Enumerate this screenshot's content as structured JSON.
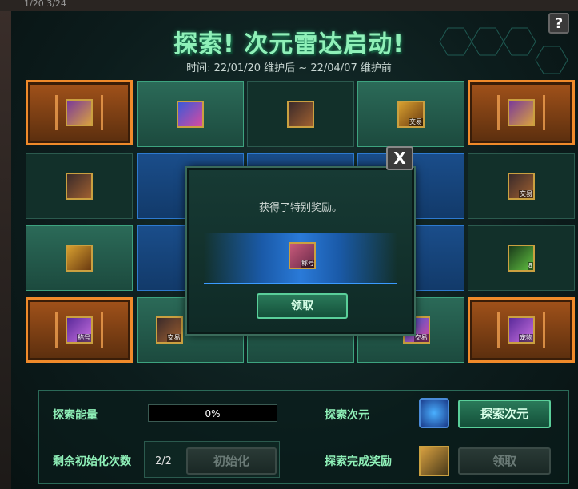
{
  "top_strip_text": "1/20  3/24",
  "help_label": "?",
  "title": "探索! 次元雷达启动!",
  "subtitle": "时间: 22/01/20 维护后 ~ 22/04/07 维护前",
  "grid": [
    {
      "tag": ""
    },
    {
      "tag": ""
    },
    {
      "tag": ""
    },
    {
      "tag": "交易"
    },
    {
      "tag": ""
    },
    {
      "tag": ""
    },
    {
      "tag": ""
    },
    {
      "tag": "交易"
    },
    {
      "tag": ""
    },
    {
      "tag": "8"
    },
    {
      "tag": "称号"
    },
    {
      "tag": "交易"
    },
    {
      "tag": "交易"
    },
    {
      "tag": "宠物"
    }
  ],
  "modal": {
    "close_label": "X",
    "message": "获得了特别奖励。",
    "reward_tag": "称号",
    "claim_label": "领取"
  },
  "bottom": {
    "energy_label": "探索能量",
    "energy_value": "0%",
    "dimension_label": "探索次元",
    "explore_button": "探索次元",
    "reset_count_label": "剩余初始化次数",
    "reset_count_value": "2/2",
    "reset_button": "初始化",
    "complete_reward_label": "探索完成奖励",
    "claim_button": "领取"
  }
}
